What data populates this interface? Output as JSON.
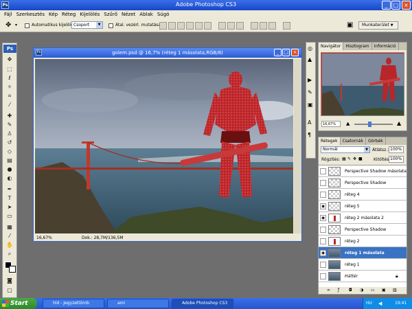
{
  "app": {
    "title": "Adobe Photoshop CS3",
    "logo": "Ps",
    "icon_label": "Ps"
  },
  "menu": [
    "Fájl",
    "Szerkesztés",
    "Kép",
    "Réteg",
    "Kijelölés",
    "Szűrő",
    "Nézet",
    "Ablak",
    "Súgó"
  ],
  "options": {
    "auto_select_label": "Automatikus kijelölés:",
    "auto_select_value": "Csoport",
    "transform_label": "Átal. vezérl. mutatása",
    "workspace_label": "Munkaterület"
  },
  "document": {
    "title": "golem.psd @ 16,7% (réteg 1 másolata,RGB/8)",
    "zoom": "16,67%",
    "doc_info": "Dok.: 28,7M/136,5M"
  },
  "navigator": {
    "tabs": [
      "Navigátor",
      "Hisztogram",
      "Információ"
    ],
    "zoom": "16,67%"
  },
  "layers": {
    "tabs": [
      "Rétegek",
      "Csatornák",
      "Görbék"
    ],
    "blend_mode": "Normál",
    "opacity_label": "Átlátsz.:",
    "opacity": "100%",
    "lock_label": "Rögzítés:",
    "fill_label": "Kitöltés:",
    "fill": "100%",
    "items": [
      {
        "name": "Perspective Shadow másolata",
        "visible": false,
        "selected": false
      },
      {
        "name": "Perspective Shadow",
        "visible": false,
        "selected": false
      },
      {
        "name": "réteg 4",
        "visible": false,
        "selected": false
      },
      {
        "name": "réteg 5",
        "visible": true,
        "selected": false
      },
      {
        "name": "réteg 2 másolata 2",
        "visible": true,
        "selected": false
      },
      {
        "name": "Perspective Shadow",
        "visible": false,
        "selected": false
      },
      {
        "name": "réteg 2",
        "visible": false,
        "selected": false
      },
      {
        "name": "réteg 1 másolata",
        "visible": true,
        "selected": true
      },
      {
        "name": "réteg 1",
        "visible": false,
        "selected": false
      },
      {
        "name": "Háttér",
        "visible": false,
        "selected": false
      }
    ]
  },
  "taskbar": {
    "start": "Start",
    "tasks": [
      "hld - Jegyzettömb",
      "ami",
      "Adobe Photoshop CS3"
    ],
    "lang": "HU",
    "time": "19:41"
  },
  "colors": {
    "xp_blue": "#2456d0",
    "selected_layer": "#3a72c4",
    "panel_bg": "#ece9d8"
  }
}
